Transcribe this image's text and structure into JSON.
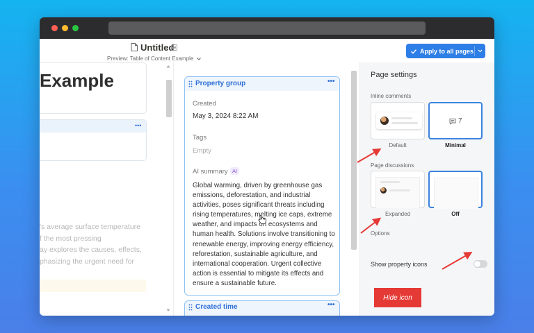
{
  "header": {
    "doc_title": "Untitled",
    "preview_label": "Preview: Table of Content Example",
    "apply_button": "Apply to all pages"
  },
  "left_preview": {
    "heading": "Example",
    "paragraph_lines": [
      "'s average surface temperature",
      "f the most pressing",
      "ay explores the causes, effects,",
      "phasizing the urgent need for"
    ]
  },
  "property_card": {
    "title": "Property group",
    "created_label": "Created",
    "created_value": "May 3, 2024 8:22 AM",
    "tags_label": "Tags",
    "tags_value": "Empty",
    "ai_summary_label": "AI summary",
    "ai_badge": "AI",
    "summary_lines": [
      "Global warming, driven by greenhouse gas",
      "emissions, deforestation, and industrial",
      "activities, poses significant threats including",
      "rising temperatures, melting ice caps, extreme",
      "weather, and impacts on ecosystems and",
      "human health. Solutions involve transitioning to",
      "renewable energy, improving energy efficiency,",
      "reforestation, sustainable agriculture, and",
      "international cooperation. Urgent collective",
      "action is essential to mitigate its effects and",
      "ensure a sustainable future."
    ]
  },
  "second_card": {
    "title": "Created time"
  },
  "settings": {
    "title": "Page settings",
    "inline_comments_label": "Inline comments",
    "inline_options": [
      {
        "caption": "Default",
        "selected": false
      },
      {
        "caption": "Minimal",
        "selected": true,
        "count": "7"
      }
    ],
    "page_discussions_label": "Page discussions",
    "discussion_options": [
      {
        "caption": "Expanded",
        "selected": false
      },
      {
        "caption": "Off",
        "selected": true
      }
    ],
    "options_label": "Options",
    "show_property_icons_label": "Show property icons",
    "show_property_icons_on": false
  },
  "annotation": {
    "hide_icon_label": "Hide icon"
  },
  "colors": {
    "accent": "#2d7ee6",
    "annotation_red": "#e53935",
    "background_top": "#14b4f0",
    "background_bottom": "#4a7fe8"
  }
}
